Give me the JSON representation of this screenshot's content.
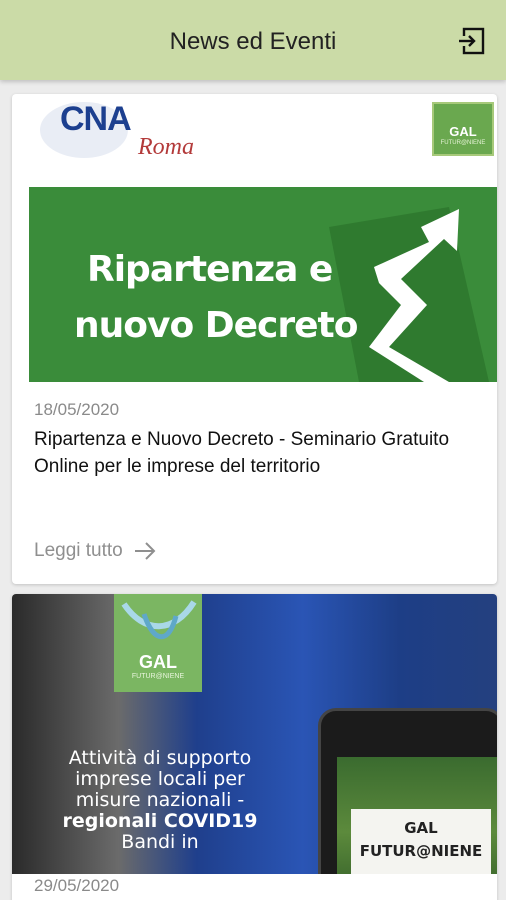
{
  "header": {
    "title": "News ed Eventi",
    "logout_icon": "logout-icon",
    "background": "#cbdba7"
  },
  "news": [
    {
      "logo_left": {
        "brand": "CNA",
        "city": "Roma"
      },
      "logo_right": {
        "brand": "GAL",
        "sub": "FUTUR@NIENE"
      },
      "banner": {
        "line1": "Ripartenza e",
        "line2": "nuovo Decreto",
        "color": "#3a8c3a"
      },
      "date": "18/05/2020",
      "title": "Ripartenza e Nuovo Decreto - Seminario Gratuito Online per le imprese del territorio",
      "read_more": "Leggi tutto",
      "read_more_icon": "arrow-right-icon"
    },
    {
      "logo": {
        "brand": "GAL",
        "sub": "FUTUR@NIENE"
      },
      "promo": {
        "line1": "Attività di supporto",
        "line2": "imprese locali per",
        "line3": "misure nazionali -",
        "line4": "regionali COVID19",
        "line5": "Bandi in"
      },
      "phone_text": {
        "line1": "GAL",
        "line2": "FUTUR@NIENE"
      },
      "date": "29/05/2020"
    }
  ]
}
